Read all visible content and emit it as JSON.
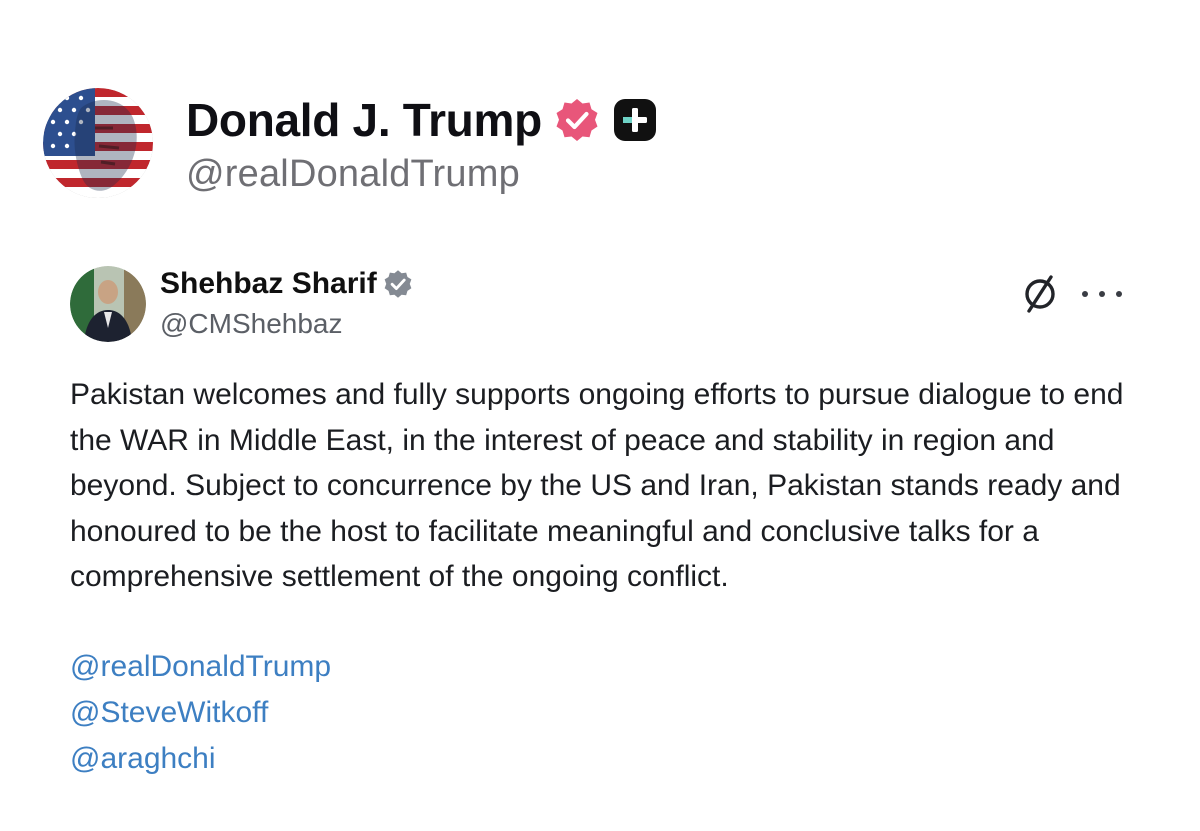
{
  "outer_post": {
    "display_name": "Donald J. Trump",
    "handle": "@realDonaldTrump",
    "verified_badge_color": "#e8567a",
    "plus_badge_color": "#111111"
  },
  "embedded_post": {
    "display_name": "Shehbaz Sharif",
    "handle": "@CMShehbaz",
    "verified_badge_color": "#848a93",
    "body": "Pakistan welcomes and fully supports ongoing efforts to pursue dialogue to end the WAR in Middle East, in the interest of peace and stability in region and beyond. Subject to concurrence by the US and Iran, Pakistan stands ready and honoured to be the host to facilitate meaningful and conclusive talks for a comprehensive settlement of the ongoing conflict.",
    "mentions": [
      "@realDonaldTrump",
      "@SteveWitkoff",
      "@araghchi"
    ],
    "mention_color": "#3d7fc2",
    "icons": [
      "grok-icon",
      "more-icon"
    ]
  }
}
